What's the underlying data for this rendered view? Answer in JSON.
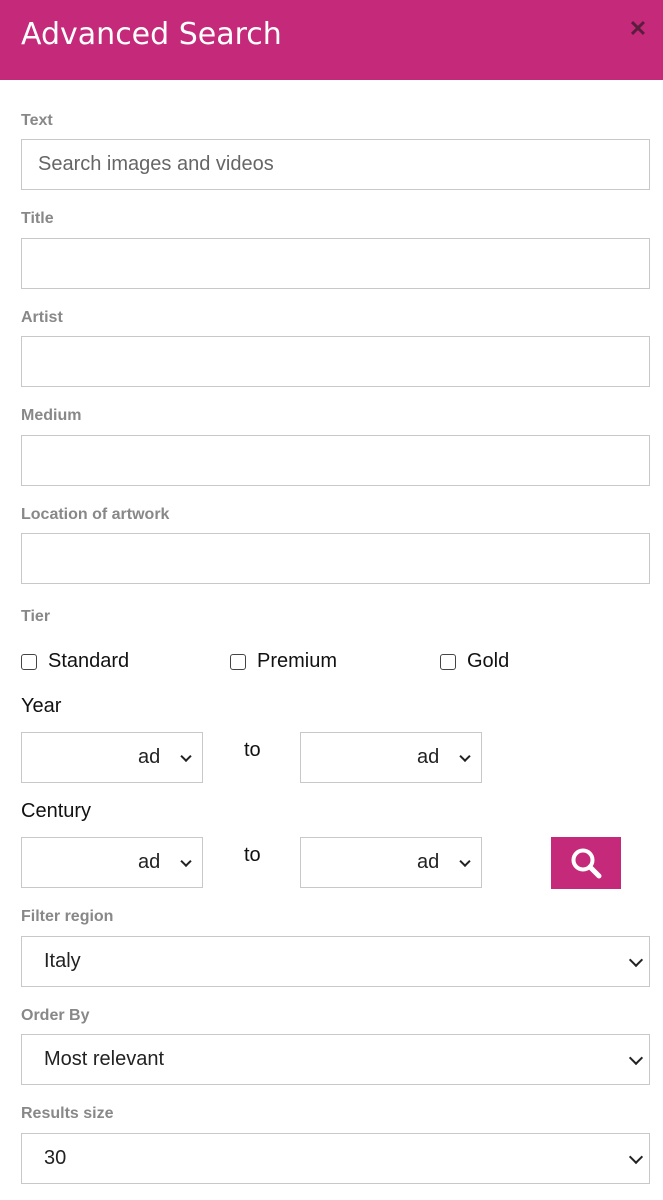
{
  "header": {
    "title": "Advanced Search",
    "close_symbol": "✕"
  },
  "fields": {
    "text": {
      "label": "Text",
      "placeholder": "Search images and videos",
      "value": ""
    },
    "title": {
      "label": "Title",
      "value": ""
    },
    "artist": {
      "label": "Artist",
      "value": ""
    },
    "medium": {
      "label": "Medium",
      "value": ""
    },
    "location": {
      "label": "Location of artwork",
      "value": ""
    }
  },
  "tier": {
    "label": "Tier",
    "options": [
      {
        "label": "Standard",
        "checked": false
      },
      {
        "label": "Premium",
        "checked": false
      },
      {
        "label": "Gold",
        "checked": false
      }
    ]
  },
  "year": {
    "label": "Year",
    "from_era": "ad",
    "to_label": "to",
    "to_era": "ad"
  },
  "century": {
    "label": "Century",
    "from_era": "ad",
    "to_label": "to",
    "to_era": "ad"
  },
  "filter_region": {
    "label": "Filter region",
    "selected": "Italy"
  },
  "order_by": {
    "label": "Order By",
    "selected": "Most relevant"
  },
  "results_size": {
    "label": "Results size",
    "selected": "30"
  },
  "colors": {
    "accent": "#c5297a",
    "close_icon": "#5a1d3e"
  },
  "icons": {
    "close": "close-icon",
    "search": "search-icon",
    "dropdown": "chevron-down-icon"
  }
}
